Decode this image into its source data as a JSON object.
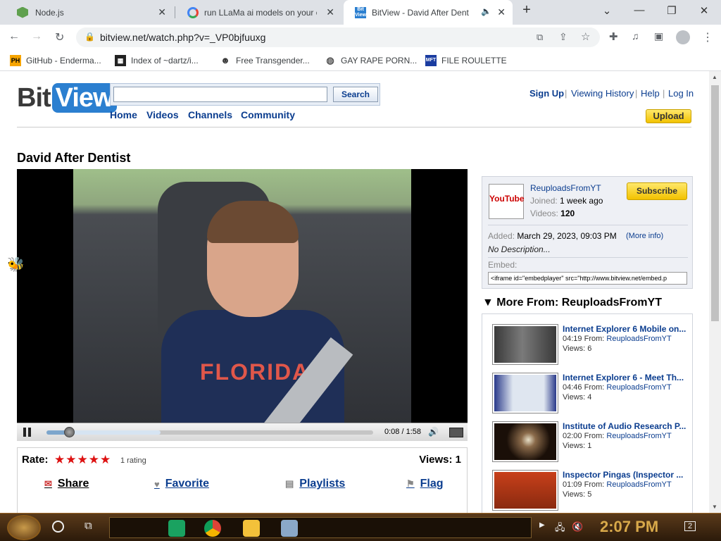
{
  "browser": {
    "tabs": [
      {
        "title": "Node.js",
        "icon": "nodejs-hexagon-icon"
      },
      {
        "title": "run LLaMa ai models on your o",
        "icon": "google-icon"
      },
      {
        "title": "BitView - David After Dent",
        "icon": "bitview-icon",
        "active": true,
        "audio": true
      }
    ],
    "new_tab": "+",
    "url": "bitview.net/watch.php?v=_VP0bjfuuxg",
    "bookmarks": [
      {
        "label": "GitHub - Enderma...",
        "icon": "ph-icon"
      },
      {
        "label": "Index of ~dartz/i...",
        "icon": "grid-icon"
      },
      {
        "label": "Free Transgender...",
        "icon": "mask-icon"
      },
      {
        "label": "GAY RAPE PORN...",
        "icon": "globe-icon"
      },
      {
        "label": "FILE ROULETTE",
        "icon": "mft-icon"
      }
    ]
  },
  "site": {
    "logo_left": "Bit",
    "logo_right": "View",
    "search_value": "",
    "search_button": "Search",
    "nav": [
      "Home",
      "Videos",
      "Channels",
      "Community"
    ],
    "user_links": [
      "Sign Up",
      "Viewing History",
      "Help",
      "Log In"
    ],
    "upload": "Upload"
  },
  "video": {
    "title": "David After Dentist",
    "shirt_text": "FLORIDA",
    "time": "0:08 / 1:58",
    "progress": 0.07,
    "buffered": 0.35,
    "rate_label": "Rate:",
    "stars": "★★★★★",
    "rating_count": "1 rating",
    "views": "Views:  1",
    "actions": [
      "Share",
      "Favorite",
      "Playlists",
      "Flag"
    ]
  },
  "channel": {
    "avatar_text": "YouTube",
    "name": "ReuploadsFromYT",
    "joined_label": "Joined:",
    "joined": "1 week ago",
    "videos_label": "Videos:",
    "videos": "120",
    "subscribe": "Subscribe",
    "added_label": "Added:",
    "added": "March 29, 2023, 09:03 PM",
    "more_info": "(More info)",
    "description": "No Description...",
    "embed_label": "Embed:",
    "embed": "<iframe id=\"embedplayer\" src=\"http://www.bitview.net/embed.p"
  },
  "more_from": {
    "heading": "More From: ReuploadsFromYT",
    "items": [
      {
        "title": "Internet Explorer 6 Mobile on...",
        "duration": "04:19",
        "from": "From:",
        "channel": "ReuploadsFromYT",
        "views": "Views: 6",
        "thumb_color": "#5a5a5a"
      },
      {
        "title": "Internet Explorer 6 - Meet Th...",
        "duration": "04:46",
        "from": "From:",
        "channel": "ReuploadsFromYT",
        "views": "Views: 4",
        "thumb_color": "#3a4aa0"
      },
      {
        "title": "Institute of Audio Research P...",
        "duration": "02:00",
        "from": "From:",
        "channel": "ReuploadsFromYT",
        "views": "Views: 1",
        "thumb_color": "#2a1a10"
      },
      {
        "title": "Inspector Pingas (Inspector ...",
        "duration": "01:09",
        "from": "From:",
        "channel": "ReuploadsFromYT",
        "views": "Views: 5",
        "thumb_color": "#c8401a"
      }
    ]
  },
  "taskbar": {
    "clock": "2:07 PM",
    "notification_count": "2"
  }
}
